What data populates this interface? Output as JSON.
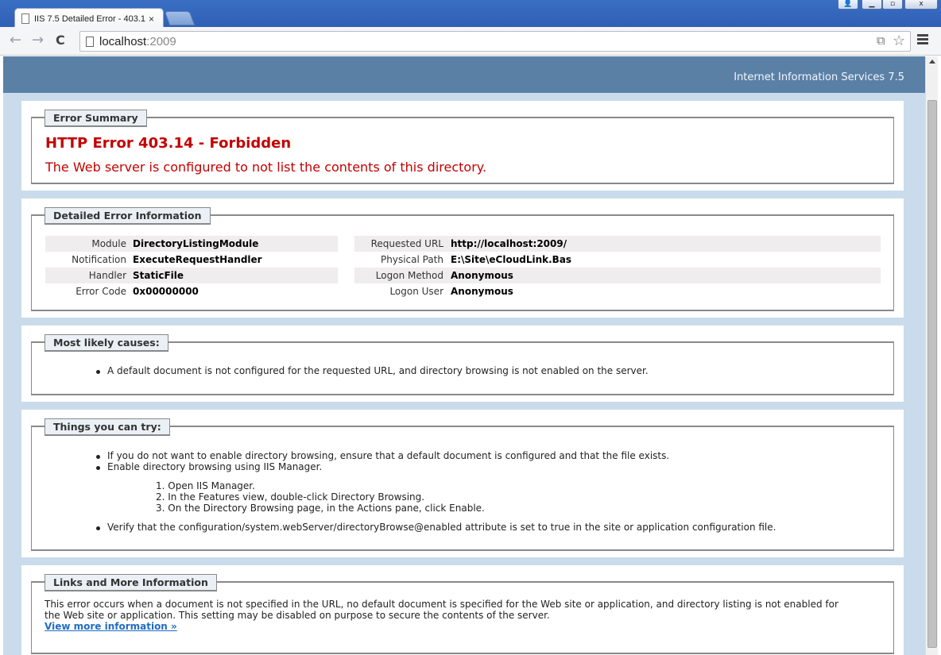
{
  "browser": {
    "tab_title": "IIS 7.5 Detailed Error - 403.1",
    "tab_close": "×",
    "url_host": "localhost",
    "url_port": ":2009",
    "window_controls": {
      "user": "👤",
      "minimize": "▁",
      "maximize": "▫",
      "close": "x"
    },
    "nav": {
      "back": "←",
      "forward": "→",
      "reload": "C"
    },
    "omnibox_icons": [
      "translate-icon",
      "star-icon"
    ],
    "star": "☆",
    "translate": "⧉"
  },
  "header": {
    "product": "Internet Information Services 7.5"
  },
  "summary": {
    "legend": "Error Summary",
    "title": "HTTP Error 403.14 - Forbidden",
    "description": "The Web server is configured to not list the contents of this directory."
  },
  "details": {
    "legend": "Detailed Error Information",
    "left": [
      {
        "label": "Module",
        "value": "DirectoryListingModule"
      },
      {
        "label": "Notification",
        "value": "ExecuteRequestHandler"
      },
      {
        "label": "Handler",
        "value": "StaticFile"
      },
      {
        "label": "Error Code",
        "value": "0x00000000"
      }
    ],
    "right": [
      {
        "label": "Requested URL",
        "value": "http://localhost:2009/"
      },
      {
        "label": "Physical Path",
        "value": "E:\\Site\\eCloudLink.Bas"
      },
      {
        "label": "Logon Method",
        "value": "Anonymous"
      },
      {
        "label": "Logon User",
        "value": "Anonymous"
      }
    ]
  },
  "causes": {
    "legend": "Most likely causes:",
    "items": [
      "A default document is not configured for the requested URL, and directory browsing is not enabled on the server."
    ]
  },
  "try": {
    "legend": "Things you can try:",
    "item1": "If you do not want to enable directory browsing, ensure that a default document is configured and that the file exists.",
    "item2": "Enable directory browsing using IIS Manager.",
    "steps": [
      "1.  Open IIS Manager.",
      "2.  In the Features view, double-click Directory Browsing.",
      "3.  On the Directory Browsing page, in the Actions pane, click Enable."
    ],
    "item3": "Verify that the configuration/system.webServer/directoryBrowse@enabled attribute is set to true in the site or application configuration file."
  },
  "links": {
    "legend": "Links and More Information",
    "line1": "This error occurs when a document is not specified in the URL, no default document is specified for the Web site or application, and directory listing is not enabled for",
    "line2": "the Web site or application. This setting may be disabled on purpose to secure the contents of the server.",
    "more": "View more information »"
  }
}
